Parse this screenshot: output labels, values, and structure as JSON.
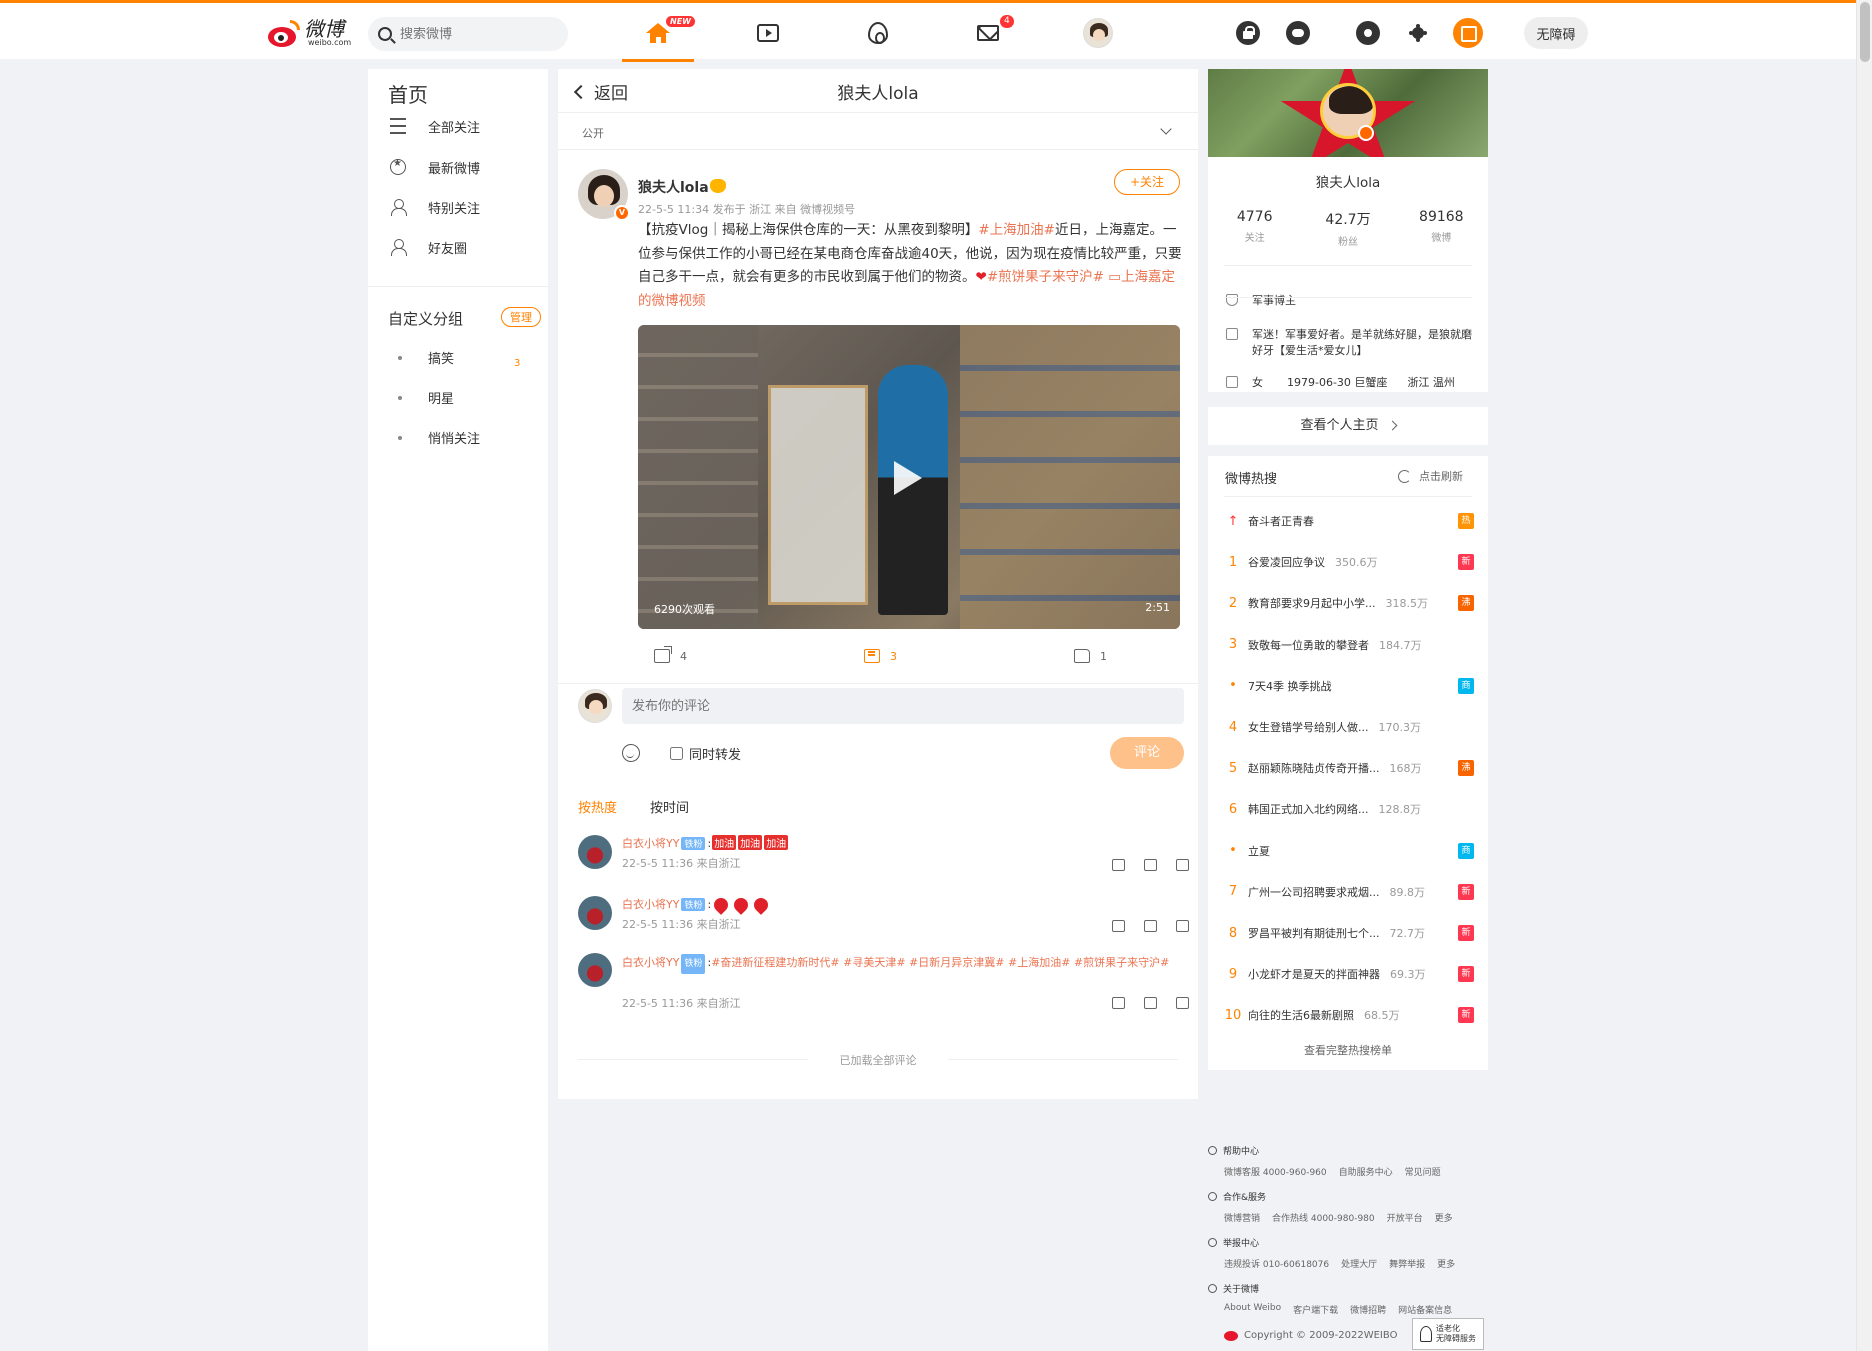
{
  "topbar": {
    "logo_cn": "微博",
    "logo_en": "weibo.com",
    "search_placeholder": "搜索微博",
    "new_badge": "NEW",
    "message_count": "4",
    "accessibility_label": "无障碍"
  },
  "left": {
    "title": "首页",
    "items": [
      {
        "label": "全部关注",
        "icon": "list-icon"
      },
      {
        "label": "最新微博",
        "icon": "star-circle-icon"
      },
      {
        "label": "特别关注",
        "icon": "user-icon"
      },
      {
        "label": "好友圈",
        "icon": "user-icon"
      }
    ],
    "group_title": "自定义分组",
    "manage_label": "管理",
    "groups": [
      {
        "label": "搞笑",
        "count": "3"
      },
      {
        "label": "明星",
        "count": ""
      },
      {
        "label": "悄悄关注",
        "count": ""
      }
    ]
  },
  "main": {
    "back_label": "返回",
    "title": "狼夫人lola",
    "visibility": "公开",
    "post": {
      "author": "狼夫人lola",
      "meta": "22-5-5 11:34  发布于 浙江  来自 微博视频号",
      "follow_label": "+关注",
      "text_1": "【抗疫Vlog｜揭秘上海保供仓库的一天：从黑夜到黎明】",
      "tag_1": "#上海加油#",
      "text_2": "近日，上海嘉定。一位参与保供工作的小哥已经在某电商仓库奋战逾40天，他说，因为现在疫情比较严重，只要自己多干一点，就会有更多的市民收到属于他们的物资。",
      "tag_2": "#煎饼果子来守沪#",
      "video_link": "上海嘉定的微博视频",
      "video_views": "6290次观看",
      "video_duration": "2:51",
      "reposts": "4",
      "comments": "3",
      "likes": "1"
    },
    "comment_box": {
      "placeholder": "发布你的评论",
      "repost_label": "同时转发",
      "submit_label": "评论"
    },
    "sort": {
      "hot": "按热度",
      "time": "按时间"
    },
    "comments": [
      {
        "user": "白衣小将YY",
        "tag": "铁粉",
        "text": "",
        "emotes": [
          "加油",
          "加油",
          "加油"
        ],
        "meta": "22-5-5 11:36 来自浙江"
      },
      {
        "user": "白衣小将YY",
        "tag": "铁粉",
        "text": "",
        "hearts": 3,
        "meta": "22-5-5 11:36 来自浙江"
      },
      {
        "user": "白衣小将YY",
        "tag": "铁粉",
        "text": "#奋进新征程建功新时代# #寻美天津# #日新月异京津冀# #上海加油# #煎饼果子来守沪#",
        "meta": "22-5-5 11:36 来自浙江"
      }
    ],
    "loaded_all": "已加载全部评论"
  },
  "profile": {
    "name": "狼夫人lola",
    "stats": [
      {
        "value": "4776",
        "label": "关注"
      },
      {
        "value": "42.7万",
        "label": "粉丝"
      },
      {
        "value": "89168",
        "label": "微博"
      }
    ],
    "verified": "军事博主",
    "bio": "军迷！军事爱好者。是羊就练好腿，是狼就磨好牙【爱生活*爱女儿】",
    "gender": "女",
    "birthday": "1979-06-30 巨蟹座",
    "location": "浙江 温州",
    "view_home": "查看个人主页"
  },
  "hot": {
    "title": "微博热搜",
    "refresh": "点击刷新",
    "items": [
      {
        "rank": "",
        "text": "奋斗者正青春",
        "count": "",
        "badge": "热",
        "badge_color": "#ff9406"
      },
      {
        "rank": "1",
        "text": "谷爱凌回应争议",
        "count": "350.6万",
        "badge": "新",
        "badge_color": "#ff3852"
      },
      {
        "rank": "2",
        "text": "教育部要求9月起中小学...",
        "count": "318.5万",
        "badge": "沸",
        "badge_color": "#f86400"
      },
      {
        "rank": "3",
        "text": "致敬每一位勇敢的攀登者",
        "count": "184.7万",
        "badge": "",
        "badge_color": ""
      },
      {
        "rank": "•",
        "text": "7天4季 换季挑战",
        "count": "",
        "badge": "商",
        "badge_color": "#00b7ee"
      },
      {
        "rank": "4",
        "text": "女生登错学号给别人做...",
        "count": "170.3万",
        "badge": "",
        "badge_color": ""
      },
      {
        "rank": "5",
        "text": "赵丽颖陈晓陆贞传奇开播...",
        "count": "168万",
        "badge": "沸",
        "badge_color": "#f86400"
      },
      {
        "rank": "6",
        "text": "韩国正式加入北约网络...",
        "count": "128.8万",
        "badge": "",
        "badge_color": ""
      },
      {
        "rank": "•",
        "text": "立夏",
        "count": "",
        "badge": "商",
        "badge_color": "#00b7ee"
      },
      {
        "rank": "7",
        "text": "广州一公司招聘要求戒烟...",
        "count": "89.8万",
        "badge": "新",
        "badge_color": "#ff3852"
      },
      {
        "rank": "8",
        "text": "罗昌平被判有期徒刑七个...",
        "count": "72.7万",
        "badge": "新",
        "badge_color": "#ff3852"
      },
      {
        "rank": "9",
        "text": "小龙虾才是夏天的拌面神器",
        "count": "69.3万",
        "badge": "新",
        "badge_color": "#ff3852"
      },
      {
        "rank": "10",
        "text": "向往的生活6最新剧照",
        "count": "68.5万",
        "badge": "新",
        "badge_color": "#ff3852"
      }
    ],
    "more": "查看完整热搜榜单"
  },
  "footer": {
    "sections": [
      {
        "title": "帮助中心",
        "links": [
          "微博客服 4000-960-960",
          "自助服务中心",
          "常见问题"
        ]
      },
      {
        "title": "合作&服务",
        "links": [
          "微博营销",
          "合作热线 4000-980-980",
          "开放平台",
          "更多"
        ]
      },
      {
        "title": "举报中心",
        "links": [
          "违规投诉 010-60618076",
          "处理大厅",
          "舞弊举报",
          "更多"
        ]
      },
      {
        "title": "关于微博",
        "links": [
          "About Weibo",
          "客户端下载",
          "微博招聘",
          "网站备案信息"
        ]
      }
    ],
    "copyright": "Copyright © 2009-2022WEIBO",
    "aged_label_1": "适老化",
    "aged_label_2": "无障碍服务"
  }
}
